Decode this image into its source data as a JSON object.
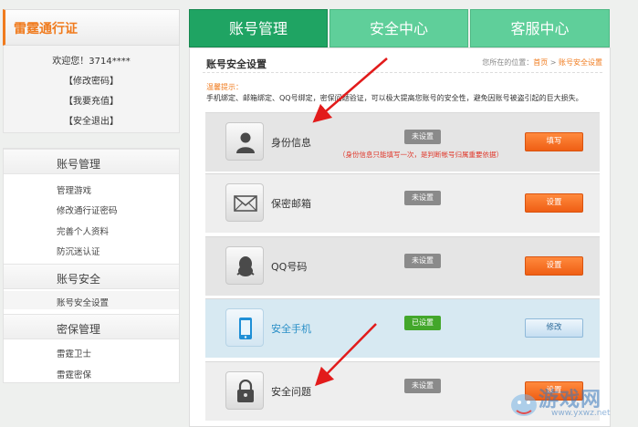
{
  "sidebar": {
    "title": "雷霆通行证",
    "welcome": "欢迎您！3714****",
    "links": [
      "【修改密码】",
      "【我要充值】",
      "【安全退出】"
    ],
    "sections": [
      {
        "title": "账号管理",
        "items": [
          "管理游戏",
          "修改通行证密码",
          "完善个人资料",
          "防沉迷认证"
        ]
      },
      {
        "title": "账号安全",
        "items": [
          "账号安全设置"
        ]
      },
      {
        "title": "密保管理",
        "items": [
          "雷霆卫士",
          "雷霆密保"
        ]
      }
    ]
  },
  "tabs": [
    "账号管理",
    "安全中心",
    "客服中心"
  ],
  "main": {
    "title": "账号安全设置",
    "breadcrumb_prefix": "您所在的位置：",
    "breadcrumb_home": "首页",
    "breadcrumb_sep": " > ",
    "breadcrumb_current": "账号安全设置",
    "tip_label": "温馨提示：",
    "tip_text": "手机绑定、邮箱绑定、QQ号绑定，密保问题验证，可以极大提高您账号的安全性，避免因账号被盗引起的巨大损失。",
    "rows": [
      {
        "label": "身份信息",
        "status": "未设置",
        "button": "填写",
        "note": "（身份信息只能填写一次，是判断帐号归属重要依据）",
        "icon": "id-person-icon"
      },
      {
        "label": "保密邮箱",
        "status": "未设置",
        "button": "设置",
        "icon": "envelope-icon"
      },
      {
        "label": "QQ号码",
        "status": "未设置",
        "button": "设置",
        "icon": "qq-penguin-icon"
      },
      {
        "label": "安全手机",
        "status": "已设置",
        "button": "修改",
        "icon": "mobile-phone-icon"
      },
      {
        "label": "安全问题",
        "status": "未设置",
        "button": "设置",
        "icon": "lock-icon"
      }
    ]
  },
  "watermark": {
    "text": "游戏网",
    "url": "www.yxwz.net"
  },
  "colors": {
    "accent": "#f07b1e",
    "tab_active": "#1fa463",
    "tab": "#5fcf9a",
    "button": "#ef5e14",
    "status_set": "#43a72b",
    "status_unset": "#8a8a8a"
  }
}
